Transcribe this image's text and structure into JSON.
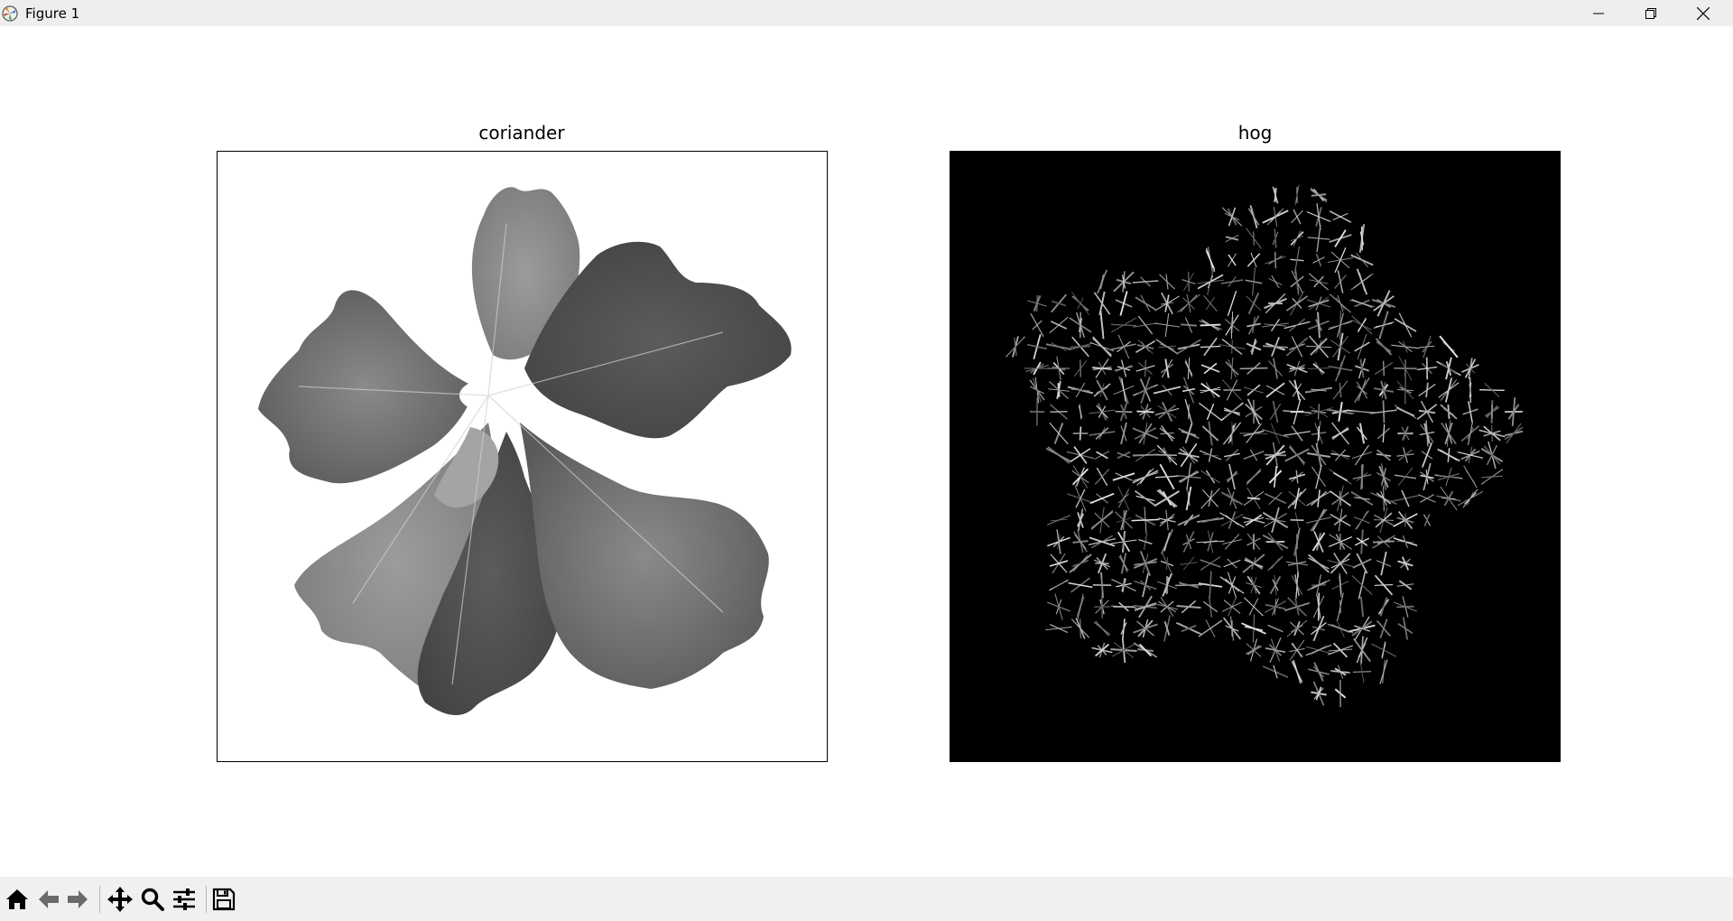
{
  "window": {
    "title": "Figure 1",
    "icons": {
      "app": "matplotlib-icon",
      "minimize": "minimize-icon",
      "maximize": "restore-icon",
      "close": "close-icon"
    }
  },
  "figure": {
    "axes": [
      {
        "title": "coriander",
        "content": "grayscale-leaf-image"
      },
      {
        "title": "hog",
        "content": "hog-visualization-image"
      }
    ]
  },
  "toolbar": {
    "tools": [
      {
        "name": "home",
        "icon": "home-icon"
      },
      {
        "name": "back",
        "icon": "arrow-left-icon"
      },
      {
        "name": "forward",
        "icon": "arrow-right-icon"
      },
      {
        "name": "pan",
        "icon": "move-icon"
      },
      {
        "name": "zoom",
        "icon": "magnifier-icon"
      },
      {
        "name": "configure-subplots",
        "icon": "sliders-icon"
      },
      {
        "name": "save",
        "icon": "floppy-disk-icon"
      }
    ]
  },
  "colors": {
    "titlebar": "#eeeeee",
    "toolbar": "#f0f0f0",
    "canvas": "#ffffff",
    "hog_background": "#000000"
  }
}
